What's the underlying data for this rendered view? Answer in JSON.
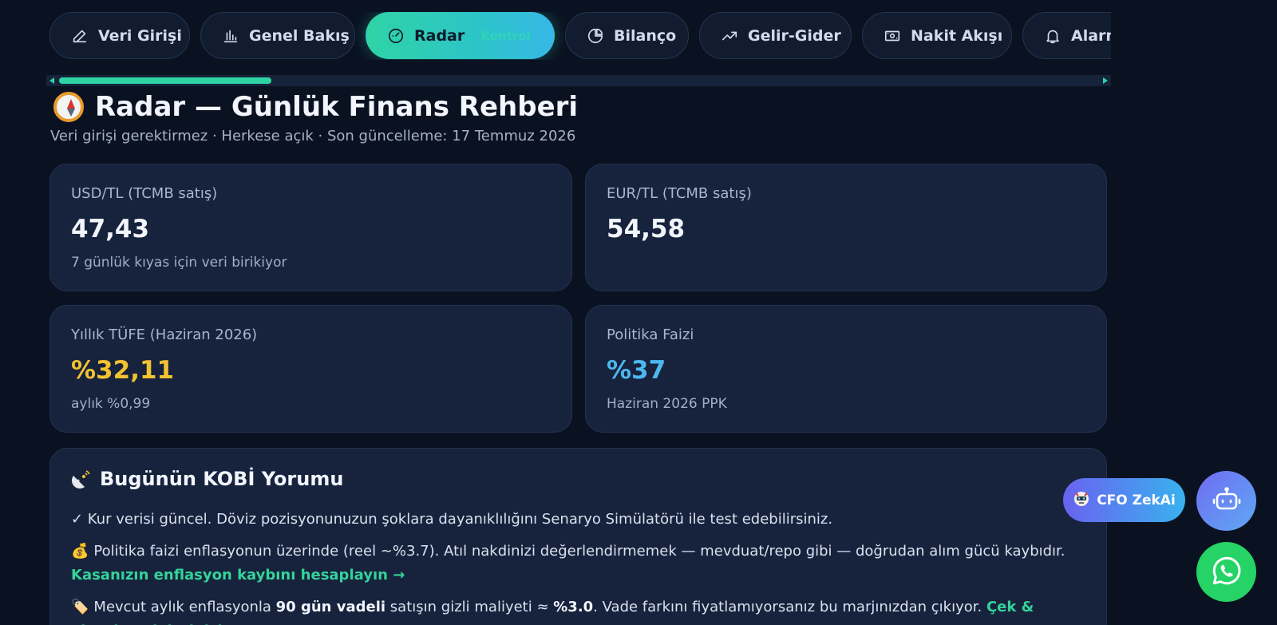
{
  "nav": {
    "tabs": [
      {
        "label": "Veri Girişi",
        "icon": "pencil-icon"
      },
      {
        "label": "Genel Bakış",
        "icon": "bar-chart-icon"
      },
      {
        "label": "Radar",
        "icon": "gauge-icon",
        "active": true
      },
      {
        "label": "Bilanço",
        "icon": "pie-chart-icon"
      },
      {
        "label": "Gelir-Gider",
        "icon": "trend-up-icon"
      },
      {
        "label": "Nakit Akışı",
        "icon": "banknote-icon"
      },
      {
        "label": "Alarm",
        "icon": "bell-icon"
      }
    ],
    "active_ghost": "Kontrol"
  },
  "page": {
    "title": "Radar — Günlük Finans Rehberi",
    "subtitle": "Veri girişi gerektirmez · Herkese açık · Son güncelleme: 17 Temmuz 2026"
  },
  "cards": {
    "usd": {
      "label": "USD/TL (TCMB satış)",
      "value": "47,43",
      "sub": "7 günlük kıyas için veri birikiyor"
    },
    "eur": {
      "label": "EUR/TL (TCMB satış)",
      "value": "54,58"
    },
    "tufe": {
      "label": "Yıllık TÜFE (Haziran 2026)",
      "value": "%32,11",
      "sub": "aylık %0,99"
    },
    "faiz": {
      "label": "Politika Faizi",
      "value": "%37",
      "sub": "Haziran 2026 PPK"
    }
  },
  "comment": {
    "title": "Bugünün KOBİ Yorumu",
    "line1": "✓ Kur verisi güncel. Döviz pozisyonunuzun şoklara dayanıklılığını Senaryo Simülatörü ile test edebilirsiniz.",
    "line2_text": "Politika faizi enflasyonun üzerinde (reel ~%3.7). Atıl nakdinizi değerlendirmemek — mevduat/repo gibi — doğrudan alım gücü kaybıdır. ",
    "line2_link": "Kasanızın enflasyon kaybını hesaplayın →",
    "line3_a": "Mevcut aylık enflasyonla ",
    "line3_b": "90 gün vadeli",
    "line3_c": " satışın gizli maliyeti ≈ ",
    "line3_d": "%3.0",
    "line3_e": ". Vade farkını fiyatlamıyorsanız bu marjınızdan çıkıyor. ",
    "line3_link": "Çek & alacak vadelerinizi"
  },
  "fab": {
    "cfo_label": "CFO ZekAi"
  },
  "colors": {
    "accent": "#2fd4a5",
    "inflation": "#f2c230",
    "rate": "#4cb8ef",
    "whatsapp": "#25d366"
  }
}
